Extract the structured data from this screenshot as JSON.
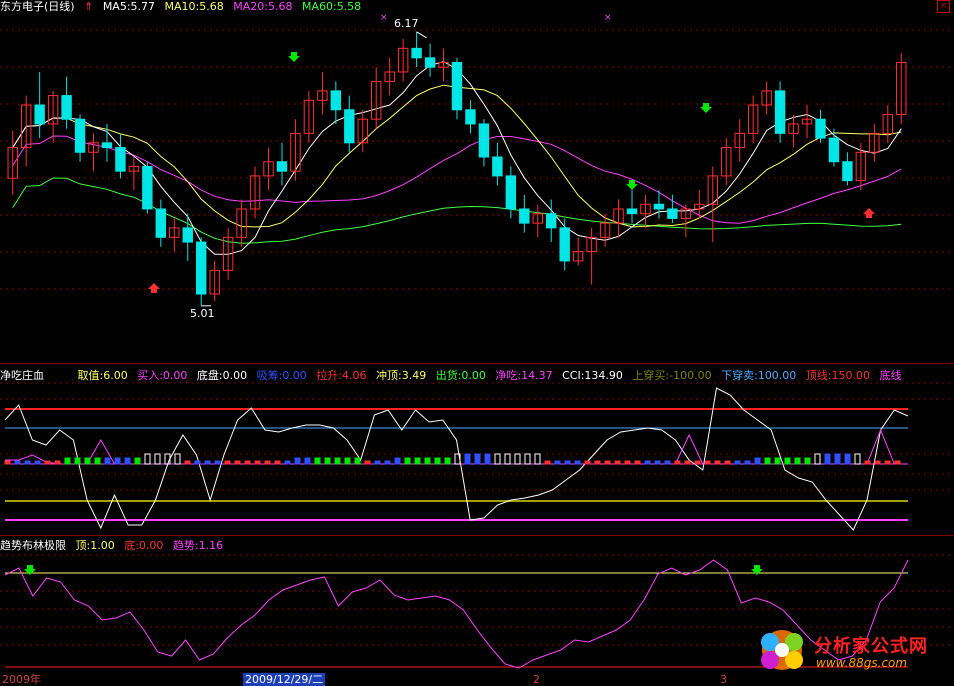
{
  "main_panel": {
    "title": "东方电子(日线)",
    "ma_labels": [
      {
        "text": "MA5:5.77",
        "color": "#ffffff"
      },
      {
        "text": "MA10:5.68",
        "color": "#ffff66"
      },
      {
        "text": "MA20:5.68",
        "color": "#ff40ff"
      },
      {
        "text": "MA60:5.58",
        "color": "#40ff40"
      }
    ],
    "high_label": "6.17",
    "low_label": "5.01",
    "colors": {
      "up": "#ff3030",
      "down": "#00e6e6",
      "ma5": "#ffffff",
      "ma10": "#ffff66",
      "ma20": "#ff40ff",
      "ma60": "#40ff40",
      "grid": "#800000"
    }
  },
  "indicator_panel": {
    "title": "净吃庄血",
    "items": [
      {
        "text": "取值:6.00",
        "color": "#ffff66"
      },
      {
        "text": "买入:0.00",
        "color": "#ff40ff"
      },
      {
        "text": "底盘:0.00",
        "color": "#ffffff"
      },
      {
        "text": "吸筹:0.00",
        "color": "#3050ff"
      },
      {
        "text": "拉升:4.06",
        "color": "#ff3030"
      },
      {
        "text": "冲顶:3.49",
        "color": "#ffff66"
      },
      {
        "text": "出货:0.00",
        "color": "#40ff40"
      },
      {
        "text": "净吃:14.37",
        "color": "#ff40ff"
      },
      {
        "text": "CCI:134.90",
        "color": "#ffffff"
      },
      {
        "text": "上穿买:-100.00",
        "color": "#808000"
      },
      {
        "text": "下穿卖:100.00",
        "color": "#4ea8ff"
      },
      {
        "text": "顶线:150.00",
        "color": "#ff3030"
      },
      {
        "text": "底线",
        "color": "#ff40ff"
      }
    ]
  },
  "trend_panel": {
    "title": "趋势布林极限",
    "items": [
      {
        "text": "顶:1.00",
        "color": "#ffff66"
      },
      {
        "text": "底:0.00",
        "color": "#ff3030"
      },
      {
        "text": "趋势:1.16",
        "color": "#ff40ff"
      }
    ]
  },
  "date_axis": {
    "labels": [
      "2009年",
      "2",
      "3"
    ],
    "cursor_label": "2009/12/29/二"
  },
  "watermark": {
    "title": "分析家公式网",
    "url": "www.88gs.com"
  },
  "chart_data": {
    "type": "candlestick",
    "title": "东方电子(日线)",
    "price_range": [
      5.0,
      6.2
    ],
    "high": 6.17,
    "low": 5.01,
    "candles": [
      {
        "o": 5.55,
        "h": 5.75,
        "l": 5.48,
        "c": 5.68
      },
      {
        "o": 5.68,
        "h": 5.9,
        "l": 5.6,
        "c": 5.86
      },
      {
        "o": 5.86,
        "h": 6.0,
        "l": 5.72,
        "c": 5.78
      },
      {
        "o": 5.78,
        "h": 5.92,
        "l": 5.7,
        "c": 5.9
      },
      {
        "o": 5.9,
        "h": 5.98,
        "l": 5.76,
        "c": 5.8
      },
      {
        "o": 5.8,
        "h": 5.82,
        "l": 5.62,
        "c": 5.66
      },
      {
        "o": 5.66,
        "h": 5.74,
        "l": 5.58,
        "c": 5.7
      },
      {
        "o": 5.7,
        "h": 5.78,
        "l": 5.62,
        "c": 5.68
      },
      {
        "o": 5.68,
        "h": 5.74,
        "l": 5.55,
        "c": 5.58
      },
      {
        "o": 5.58,
        "h": 5.64,
        "l": 5.5,
        "c": 5.6
      },
      {
        "o": 5.6,
        "h": 5.62,
        "l": 5.4,
        "c": 5.42
      },
      {
        "o": 5.42,
        "h": 5.46,
        "l": 5.26,
        "c": 5.3
      },
      {
        "o": 5.3,
        "h": 5.38,
        "l": 5.24,
        "c": 5.34
      },
      {
        "o": 5.34,
        "h": 5.4,
        "l": 5.2,
        "c": 5.28
      },
      {
        "o": 5.28,
        "h": 5.3,
        "l": 5.01,
        "c": 5.06
      },
      {
        "o": 5.06,
        "h": 5.2,
        "l": 5.03,
        "c": 5.16
      },
      {
        "o": 5.16,
        "h": 5.34,
        "l": 5.12,
        "c": 5.3
      },
      {
        "o": 5.3,
        "h": 5.46,
        "l": 5.26,
        "c": 5.42
      },
      {
        "o": 5.42,
        "h": 5.6,
        "l": 5.38,
        "c": 5.56
      },
      {
        "o": 5.56,
        "h": 5.68,
        "l": 5.5,
        "c": 5.62
      },
      {
        "o": 5.62,
        "h": 5.7,
        "l": 5.52,
        "c": 5.58
      },
      {
        "o": 5.58,
        "h": 5.8,
        "l": 5.54,
        "c": 5.74
      },
      {
        "o": 5.74,
        "h": 5.92,
        "l": 5.7,
        "c": 5.88
      },
      {
        "o": 5.88,
        "h": 6.0,
        "l": 5.82,
        "c": 5.92
      },
      {
        "o": 5.92,
        "h": 5.96,
        "l": 5.78,
        "c": 5.84
      },
      {
        "o": 5.84,
        "h": 5.9,
        "l": 5.66,
        "c": 5.7
      },
      {
        "o": 5.7,
        "h": 5.84,
        "l": 5.66,
        "c": 5.8
      },
      {
        "o": 5.8,
        "h": 6.02,
        "l": 5.76,
        "c": 5.96
      },
      {
        "o": 5.96,
        "h": 6.06,
        "l": 5.9,
        "c": 6.0
      },
      {
        "o": 6.0,
        "h": 6.14,
        "l": 5.96,
        "c": 6.1
      },
      {
        "o": 6.1,
        "h": 6.17,
        "l": 6.02,
        "c": 6.06
      },
      {
        "o": 6.06,
        "h": 6.12,
        "l": 5.98,
        "c": 6.02
      },
      {
        "o": 6.02,
        "h": 6.1,
        "l": 5.96,
        "c": 6.04
      },
      {
        "o": 6.04,
        "h": 6.06,
        "l": 5.8,
        "c": 5.84
      },
      {
        "o": 5.84,
        "h": 5.88,
        "l": 5.74,
        "c": 5.78
      },
      {
        "o": 5.78,
        "h": 5.8,
        "l": 5.6,
        "c": 5.64
      },
      {
        "o": 5.64,
        "h": 5.7,
        "l": 5.52,
        "c": 5.56
      },
      {
        "o": 5.56,
        "h": 5.6,
        "l": 5.38,
        "c": 5.42
      },
      {
        "o": 5.42,
        "h": 5.48,
        "l": 5.32,
        "c": 5.36
      },
      {
        "o": 5.36,
        "h": 5.44,
        "l": 5.3,
        "c": 5.4
      },
      {
        "o": 5.4,
        "h": 5.46,
        "l": 5.28,
        "c": 5.34
      },
      {
        "o": 5.34,
        "h": 5.38,
        "l": 5.16,
        "c": 5.2
      },
      {
        "o": 5.2,
        "h": 5.3,
        "l": 5.18,
        "c": 5.24
      },
      {
        "o": 5.24,
        "h": 5.34,
        "l": 5.1,
        "c": 5.3
      },
      {
        "o": 5.3,
        "h": 5.4,
        "l": 5.26,
        "c": 5.36
      },
      {
        "o": 5.36,
        "h": 5.46,
        "l": 5.3,
        "c": 5.42
      },
      {
        "o": 5.42,
        "h": 5.5,
        "l": 5.36,
        "c": 5.4
      },
      {
        "o": 5.4,
        "h": 5.48,
        "l": 5.34,
        "c": 5.44
      },
      {
        "o": 5.44,
        "h": 5.5,
        "l": 5.38,
        "c": 5.42
      },
      {
        "o": 5.42,
        "h": 5.48,
        "l": 5.36,
        "c": 5.38
      },
      {
        "o": 5.38,
        "h": 5.44,
        "l": 5.3,
        "c": 5.42
      },
      {
        "o": 5.42,
        "h": 5.5,
        "l": 5.38,
        "c": 5.44
      },
      {
        "o": 5.44,
        "h": 5.6,
        "l": 5.28,
        "c": 5.56
      },
      {
        "o": 5.56,
        "h": 5.72,
        "l": 5.52,
        "c": 5.68
      },
      {
        "o": 5.68,
        "h": 5.8,
        "l": 5.62,
        "c": 5.74
      },
      {
        "o": 5.74,
        "h": 5.9,
        "l": 5.7,
        "c": 5.86
      },
      {
        "o": 5.86,
        "h": 5.96,
        "l": 5.82,
        "c": 5.92
      },
      {
        "o": 5.92,
        "h": 5.96,
        "l": 5.7,
        "c": 5.74
      },
      {
        "o": 5.74,
        "h": 5.82,
        "l": 5.68,
        "c": 5.78
      },
      {
        "o": 5.78,
        "h": 5.86,
        "l": 5.72,
        "c": 5.8
      },
      {
        "o": 5.8,
        "h": 5.84,
        "l": 5.7,
        "c": 5.72
      },
      {
        "o": 5.72,
        "h": 5.76,
        "l": 5.6,
        "c": 5.62
      },
      {
        "o": 5.62,
        "h": 5.66,
        "l": 5.52,
        "c": 5.54
      },
      {
        "o": 5.54,
        "h": 5.7,
        "l": 5.5,
        "c": 5.66
      },
      {
        "o": 5.66,
        "h": 5.78,
        "l": 5.62,
        "c": 5.74
      },
      {
        "o": 5.74,
        "h": 5.86,
        "l": 5.7,
        "c": 5.82
      },
      {
        "o": 5.82,
        "h": 6.08,
        "l": 5.78,
        "c": 6.04
      }
    ]
  }
}
